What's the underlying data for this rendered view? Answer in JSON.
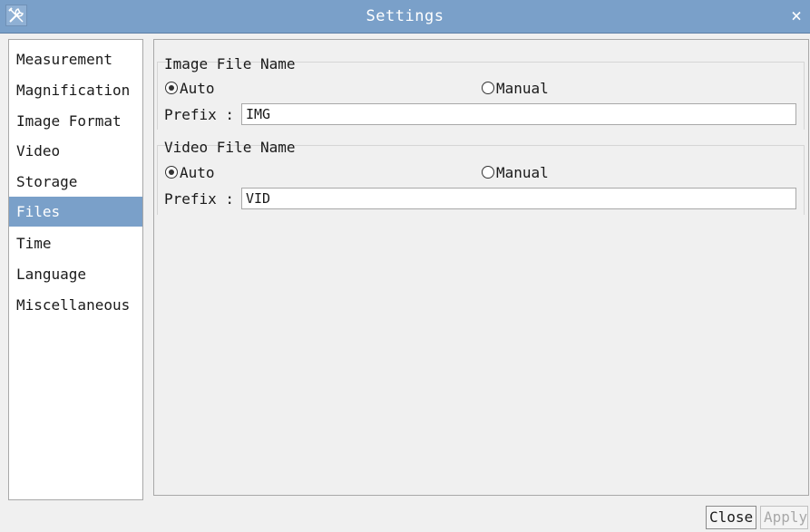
{
  "window": {
    "title": "Settings",
    "app_icon": "tools-icon",
    "close_icon": "close-icon",
    "close_glyph": "×"
  },
  "sidebar": {
    "items": [
      {
        "label": "Measurement",
        "selected": false
      },
      {
        "label": "Magnification",
        "selected": false
      },
      {
        "label": "Image Format",
        "selected": false
      },
      {
        "label": "Video",
        "selected": false
      },
      {
        "label": "Storage",
        "selected": false
      },
      {
        "label": "Files",
        "selected": true
      },
      {
        "label": "Time",
        "selected": false
      },
      {
        "label": "Language",
        "selected": false
      },
      {
        "label": "Miscellaneous",
        "selected": false
      }
    ]
  },
  "image_file": {
    "title": "Image File Name",
    "auto_label": "Auto",
    "manual_label": "Manual",
    "selected": "Auto",
    "prefix_label": "Prefix :",
    "prefix_value": "IMG"
  },
  "video_file": {
    "title": "Video File Name",
    "auto_label": "Auto",
    "manual_label": "Manual",
    "selected": "Auto",
    "prefix_label": "Prefix :",
    "prefix_value": "VID"
  },
  "footer": {
    "close_label": "Close",
    "apply_label": "Apply",
    "apply_enabled": false
  },
  "colors": {
    "accent": "#7aa0c9",
    "background": "#f0f0f0"
  }
}
